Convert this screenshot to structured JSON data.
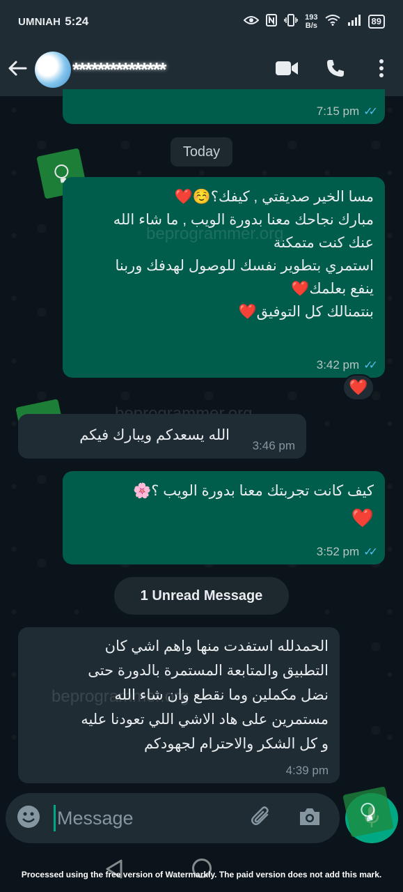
{
  "status_bar": {
    "carrier": "UMNIAH",
    "time": "5:24",
    "speed_value": "193",
    "speed_unit": "B/s",
    "battery": "89"
  },
  "header": {
    "contact_name": "***************",
    "icons": [
      "back-arrow-icon",
      "video-call-icon",
      "phone-icon",
      "more-vert-icon"
    ]
  },
  "chat": {
    "prev_message_time": "7:15 pm",
    "date_divider": "Today",
    "messages": [
      {
        "direction": "out",
        "lines": [
          "مسا الخير صديقتي , كيفك؟☺️❤️",
          "مبارك نجاحك معنا بدورة الويب , ما شاء الله",
          "عنك كنت متمكنة",
          "استمري بتطوير نفسك للوصول لهدفك وربنا",
          "ينفع بعلمك❤️",
          "بنتمنالك كل التوفيق❤️"
        ],
        "time": "3:42 pm",
        "reaction": "❤️"
      },
      {
        "direction": "in",
        "lines": [
          "الله يسعدكم ويبارك فيكم"
        ],
        "time": "3:46 pm"
      },
      {
        "direction": "out",
        "lines": [
          "كيف كانت تجربتك معنا بدورة الويب ؟🌸",
          "❤️"
        ],
        "time": "3:52 pm"
      },
      {
        "direction": "in",
        "lines": [
          "الحمدلله استفدت منها واهم اشي كان",
          "التطبيق والمتابعة المستمرة بالدورة حتى",
          "نضل مكملين وما نقطع وان شاء الله",
          "مستمرين على هاد الاشي اللي تعودنا عليه",
          "و كل الشكر والاحترام لجهودكم"
        ],
        "time": "4:39 pm"
      }
    ],
    "unread_divider": "1 Unread Message",
    "watermark": "beprogrammer.org"
  },
  "input_bar": {
    "placeholder": "Message",
    "icons": [
      "emoji-icon",
      "attach-icon",
      "camera-icon",
      "mic-icon"
    ]
  },
  "footer_note": "Processed using the free version of Watermarkly. The paid version does not add this mark.",
  "colors": {
    "background": "#0b141a",
    "header": "#1f2c34",
    "outgoing_bubble": "#005c4b",
    "incoming_bubble": "#202c33",
    "accent": "#00a884",
    "read_ticks": "#53bdeb"
  }
}
